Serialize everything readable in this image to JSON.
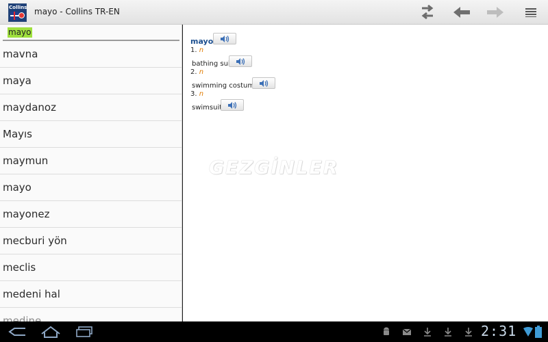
{
  "app": {
    "title": "mayo - Collins TR-EN",
    "icon_label": "Collins",
    "accent": "#1c4f8f"
  },
  "actionbar": {
    "icons": [
      "swap-icon",
      "back-arrow-icon",
      "forward-arrow-icon",
      "menu-icon"
    ]
  },
  "search": {
    "value": "mayo",
    "highlight": "#9fe03d"
  },
  "word_list": [
    "mavna",
    "maya",
    "maydanoz",
    "Mayıs",
    "maymun",
    "mayo",
    "mayonez",
    "mecburi yön",
    "meclis",
    "medeni hal",
    "medine"
  ],
  "entry": {
    "headword": "mayo",
    "senses": [
      {
        "number": "1.",
        "pos": "n",
        "translation": "bathing suit"
      },
      {
        "number": "2.",
        "pos": "n",
        "translation": "swimming costume"
      },
      {
        "number": "3.",
        "pos": "n",
        "translation": "swimsuit"
      }
    ]
  },
  "watermark": "GEZGİNLER",
  "statusbar": {
    "time": "2:31",
    "icons": [
      "android-icon",
      "gmail-icon",
      "download-icon",
      "download-icon",
      "download-icon",
      "wifi-icon",
      "battery-icon"
    ]
  }
}
